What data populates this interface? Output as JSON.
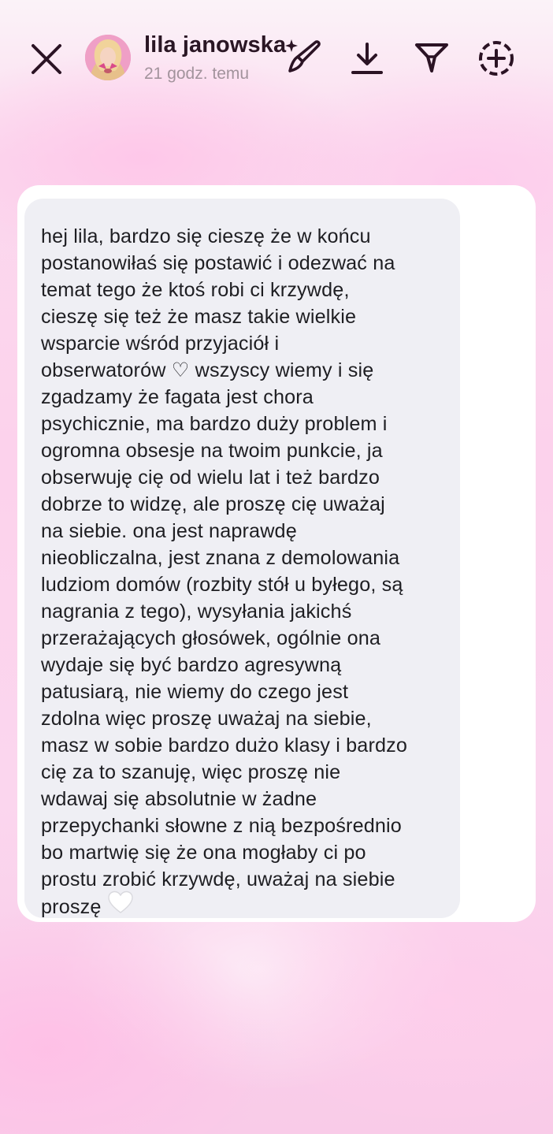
{
  "header": {
    "username": "lila janowska",
    "timestamp": "21 godz. temu",
    "close_icon": "close-icon",
    "draw_icon": "sparkle-brush-icon",
    "download_icon": "download-icon",
    "filter_icon": "filter-icon",
    "add_icon": "add-circle-icon"
  },
  "message": {
    "lines": [
      "hej lila, bardzo się cieszę że w końcu",
      "postanowiłaś się postawić i odezwać na",
      "temat tego że ktoś robi ci krzywdę,",
      "cieszę się też że masz takie wielkie",
      "wsparcie wśród przyjaciół i",
      "obserwatorów ♡ wszyscy wiemy i się",
      "zgadzamy że fagata jest chora",
      "psychicznie, ma bardzo duży problem i",
      "ogromna obsesje na twoim punkcie, ja",
      "obserwuję cię od wielu lat i też bardzo",
      "dobrze to widzę, ale proszę cię uważaj",
      "na siebie. ona jest naprawdę",
      "nieobliczalna, jest znana z demolowania",
      "ludziom domów (rozbity stół u byłego, są",
      "nagrania z tego), wysyłania jakichś",
      "przerażających głosówek, ogólnie ona",
      "wydaje się być bardzo agresywną",
      "patusiarą, nie wiemy do czego jest",
      "zdolna więc proszę uważaj na siebie,",
      "masz w sobie bardzo dużo klasy i bardzo",
      "cię za to szanuję, więc proszę nie",
      "wdawaj się absolutnie w żadne",
      "przepychanki słowne z nią bezpośrednio",
      "bo martwię się że ona mogłaby ci po",
      "prostu zrobić krzywdę, uważaj na siebie",
      "proszę"
    ],
    "end_emoji": "white-heart-icon"
  },
  "colors": {
    "bubble_bg": "#efeff4",
    "card_bg": "#ffffff",
    "text": "#1e1e22",
    "header_text": "#2a1624",
    "timestamp_text": "#a2939c",
    "icons": "#2b1324"
  }
}
